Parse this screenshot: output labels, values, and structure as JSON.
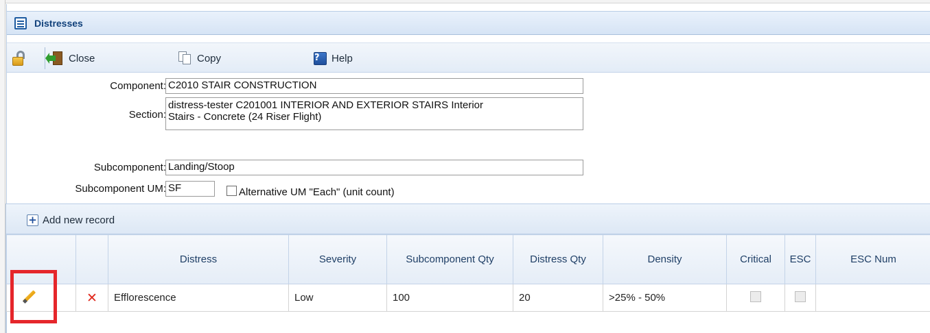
{
  "window": {
    "title": "Distresses",
    "icon": "document-list-icon"
  },
  "toolbar": {
    "lock_icon": "unlock-icon",
    "close_label": "Close",
    "copy_label": "Copy",
    "help_label": "Help"
  },
  "form": {
    "component_label": "Component:",
    "component_value": "C2010 STAIR CONSTRUCTION",
    "section_label": "Section:",
    "section_value_line1": "distress-tester C201001 INTERIOR AND EXTERIOR STAIRS Interior",
    "section_value_line2": "Stairs - Concrete (24 Riser Flight)",
    "subcomponent_label": "Subcomponent:",
    "subcomponent_value": "Landing/Stoop",
    "subcomponent_um_label": "Subcomponent UM:",
    "subcomponent_um_value": "SF",
    "alt_um_label": "Alternative UM \"Each\" (unit count)",
    "alt_um_checked": false
  },
  "grid": {
    "add_label": "Add new record",
    "columns": [
      "",
      "",
      "Distress",
      "Severity",
      "Subcomponent Qty",
      "Distress Qty",
      "Density",
      "Critical",
      "ESC",
      "ESC Num"
    ],
    "rows": [
      {
        "distress": "Efflorescence",
        "severity": "Low",
        "subcomponent_qty": "100",
        "distress_qty": "20",
        "density": ">25% - 50%",
        "critical": false,
        "esc": false,
        "esc_num": ""
      }
    ]
  },
  "colors": {
    "highlight": "#e5262b",
    "delete": "#e0291d",
    "title": "#10407a"
  }
}
